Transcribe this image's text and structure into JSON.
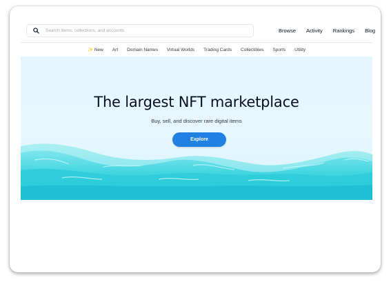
{
  "search": {
    "placeholder": "Search items, collections, and accounts",
    "icon": "search-icon"
  },
  "nav": {
    "items": [
      "Browse",
      "Activity",
      "Rankings",
      "Blog"
    ]
  },
  "categories": [
    "✨ New",
    "Art",
    "Domain Names",
    "Virtual Worlds",
    "Trading Cards",
    "Collectibles",
    "Sports",
    "Utility"
  ],
  "hero": {
    "title": "The largest NFT marketplace",
    "subtitle": "Buy, sell, and discover rare digital items",
    "button_label": "Explore"
  },
  "colors": {
    "accent": "#2081e2",
    "text": "#04111d",
    "sky": "#e6f6fe",
    "water": "#3fd3dc"
  }
}
